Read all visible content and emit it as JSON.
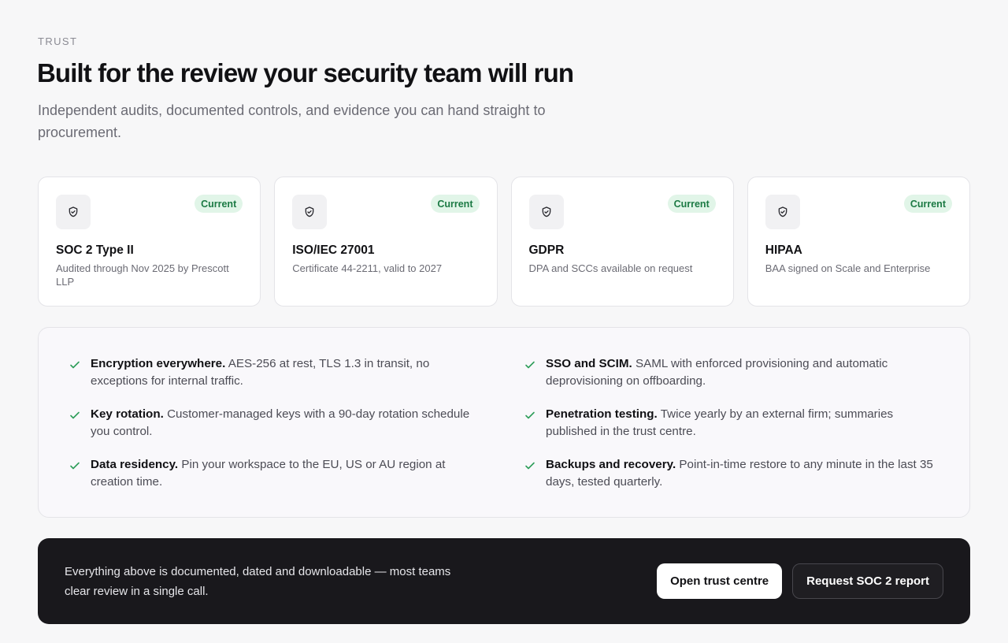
{
  "header": {
    "eyebrow": "TRUST",
    "title": "Built for the review your security team will run",
    "subtitle": "Independent audits, documented controls, and evidence you can hand straight to procurement."
  },
  "certifications": [
    {
      "icon": "shield-check-icon",
      "badge": "Current",
      "title": "SOC 2 Type II",
      "description": "Audited through Nov 2025 by Prescott LLP"
    },
    {
      "icon": "shield-check-icon",
      "badge": "Current",
      "title": "ISO/IEC 27001",
      "description": "Certificate 44-2211, valid to 2027"
    },
    {
      "icon": "shield-check-icon",
      "badge": "Current",
      "title": "GDPR",
      "description": "DPA and SCCs available on request"
    },
    {
      "icon": "shield-check-icon",
      "badge": "Current",
      "title": "HIPAA",
      "description": "BAA signed on Scale and Enterprise"
    }
  ],
  "features": [
    {
      "title": "Encryption everywhere.",
      "text": "AES-256 at rest, TLS 1.3 in transit, no exceptions for internal traffic."
    },
    {
      "title": "SSO and SCIM.",
      "text": "SAML with enforced provisioning and automatic deprovisioning on offboarding."
    },
    {
      "title": "Key rotation.",
      "text": "Customer-managed keys with a 90-day rotation schedule you control."
    },
    {
      "title": "Penetration testing.",
      "text": "Twice yearly by an external firm; summaries published in the trust centre."
    },
    {
      "title": "Data residency.",
      "text": "Pin your workspace to the EU, US or AU region at creation time."
    },
    {
      "title": "Backups and recovery.",
      "text": "Point-in-time restore to any minute in the last 35 days, tested quarterly."
    }
  ],
  "cta": {
    "text": "Everything above is documented, dated and downloadable — most teams clear review in a single call.",
    "primary_label": "Open trust centre",
    "secondary_label": "Request SOC 2 report"
  },
  "colors": {
    "badge_bg": "#e1f5e8",
    "badge_text": "#1c7a44",
    "check": "#2f9e5a",
    "cta_bg": "#19181c"
  }
}
